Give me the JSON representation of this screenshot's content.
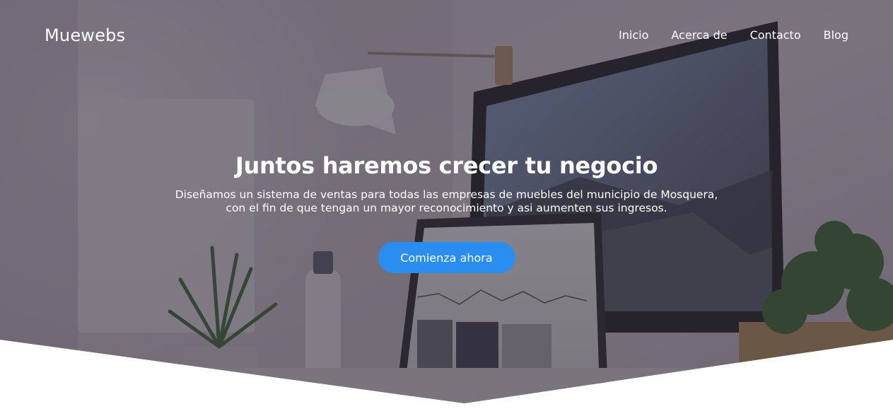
{
  "brand": {
    "name": "Muewebs"
  },
  "nav": {
    "items": [
      {
        "label": "Inicio"
      },
      {
        "label": "Acerca de"
      },
      {
        "label": "Contacto"
      },
      {
        "label": "Blog"
      }
    ]
  },
  "hero": {
    "title": "Juntos haremos crecer tu negocio",
    "subtitle_line1": "Diseñamos un sistema de ventas para todas las empresas de muebles del municipio de Mosquera,",
    "subtitle_line2": "con el fin de que tengan un mayor reconocimiento y asi aumenten sus ingresos.",
    "cta_label": "Comienza ahora",
    "background_image": "desk-workspace-photo"
  },
  "colors": {
    "accent": "#2a8df0",
    "overlay": "#2d2634",
    "text": "#ffffff"
  }
}
